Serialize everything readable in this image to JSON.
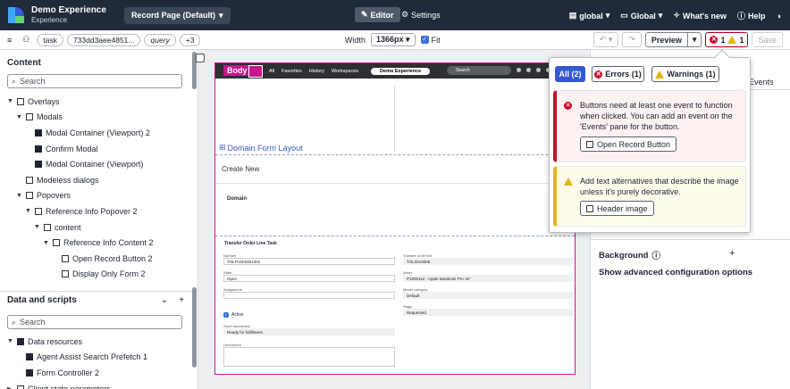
{
  "app": {
    "name": "Demo Experience",
    "subtitle": "Experience",
    "page_selector": "Record Page (Default)"
  },
  "topbar": {
    "editor_label": "Editor",
    "settings_label": "Settings",
    "scope_label": "global",
    "global_label": "Global",
    "whats_new_label": "What's new",
    "help_label": "Help"
  },
  "toolbar": {
    "chips": [
      "task",
      "733dd3aee4851...",
      "query",
      "+3"
    ],
    "width_label": "Width",
    "width_value": "1366px",
    "fit_label": "Fit",
    "preview_label": "Preview",
    "error_count": "1",
    "warning_count": "1",
    "save_label": "Save"
  },
  "content_panel": {
    "title": "Content",
    "search_placeholder": "Search",
    "tree": [
      {
        "label": "Overlays",
        "depth": 0,
        "toggle": "▼",
        "icon": "overlay-icon"
      },
      {
        "label": "Modals",
        "depth": 1,
        "toggle": "▼",
        "icon": "modal-icon"
      },
      {
        "label": "Modal Container (Viewport) 2",
        "depth": 2,
        "toggle": "",
        "icon": "component-icon"
      },
      {
        "label": "Confirm Modal",
        "depth": 2,
        "toggle": "",
        "icon": "component-icon"
      },
      {
        "label": "Modal Container (Viewport)",
        "depth": 2,
        "toggle": "",
        "icon": "component-icon"
      },
      {
        "label": "Modeless dialogs",
        "depth": 1,
        "toggle": "",
        "icon": "dialog-icon"
      },
      {
        "label": "Popovers",
        "depth": 1,
        "toggle": "▼",
        "icon": "popover-icon"
      },
      {
        "label": "Reference Info Popover 2",
        "depth": 2,
        "toggle": "▼",
        "icon": "popover-icon"
      },
      {
        "label": "content",
        "depth": 3,
        "toggle": "▼",
        "icon": "slot-icon"
      },
      {
        "label": "Reference Info Content 2",
        "depth": 4,
        "toggle": "▼",
        "icon": "container-icon"
      },
      {
        "label": "Open Record Button 2",
        "depth": 5,
        "toggle": "",
        "icon": "button-icon"
      },
      {
        "label": "Display Only Form 2",
        "depth": 5,
        "toggle": "",
        "icon": "form-icon"
      }
    ]
  },
  "data_panel": {
    "title": "Data and scripts",
    "search_placeholder": "Search",
    "tree": [
      {
        "label": "Data resources",
        "depth": 0,
        "toggle": "▼",
        "icon": "database-icon"
      },
      {
        "label": "Agent Assist Search Prefetch 1",
        "depth": 1,
        "toggle": "",
        "icon": "database-icon"
      },
      {
        "label": "Form Controller 2",
        "depth": 1,
        "toggle": "",
        "icon": "database-icon"
      },
      {
        "label": "Client state parameters",
        "depth": 0,
        "toggle": "▶",
        "icon": "state-icon"
      }
    ]
  },
  "canvas": {
    "body_tag": "Body",
    "mini_nav": [
      "All",
      "Favorites",
      "History",
      "Workspaces"
    ],
    "mini_pill": "Demo Experience",
    "mini_search": "Search",
    "domain_form_layout": "Domain Form Layout",
    "create_new": "Create New",
    "domain_heading": "Domain",
    "form": {
      "title": "Transfer Order Line Task",
      "fields": [
        {
          "label": "Number",
          "value": "TOLTASK0001001",
          "col": "left",
          "row": 0,
          "ro": false
        },
        {
          "label": "Transfer order line",
          "value": "TOL0010005",
          "col": "right",
          "row": 0,
          "ro": true
        },
        {
          "label": "State",
          "value": "Open",
          "col": "left",
          "row": 1,
          "ro": false
        },
        {
          "label": "Asset",
          "value": "P1000112 - Apple MacBook Pro 15\"",
          "col": "right",
          "row": 1,
          "ro": true
        },
        {
          "label": "Assigned to",
          "value": "",
          "col": "left",
          "row": 2,
          "ro": false
        },
        {
          "label": "Model category",
          "value": "Default",
          "col": "right",
          "row": 2,
          "ro": true
        },
        {
          "label": "Stage",
          "value": "Requested",
          "col": "right",
          "row": 3,
          "ro": true
        },
        {
          "label": "Short description",
          "value": "Ready for fulfillment",
          "col": "left",
          "row": 4,
          "ro": true
        },
        {
          "label": "Description",
          "value": "",
          "col": "left",
          "row": 5,
          "ro": false
        }
      ],
      "active_label": "Active"
    }
  },
  "right_panel": {
    "events_tab": "Events",
    "background_label": "Background",
    "advanced_label": "Show advanced configuration options"
  },
  "issues_popover": {
    "filters": {
      "all": "All (2)",
      "errors": "Errors (1)",
      "warnings": "Warnings (1)"
    },
    "error": {
      "message": "Buttons need at least one event to function when clicked. You can add an event on the 'Events' pane for the button.",
      "link": "Open Record Button"
    },
    "warning": {
      "message": "Add text alternatives that describe the image unless it's purely decorative.",
      "link": "Header image"
    }
  },
  "colors": {
    "topbar": "#1f2b3a",
    "accent": "#3558d1",
    "selection": "#c9158c",
    "error": "#c8102e",
    "warning": "#e7b416"
  }
}
